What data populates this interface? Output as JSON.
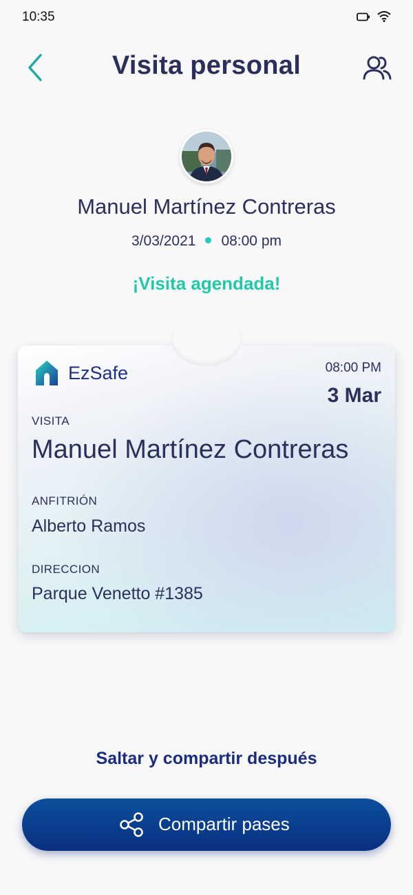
{
  "status_bar": {
    "time": "10:35"
  },
  "header": {
    "title": "Visita personal",
    "back_icon": "chevron-left-icon",
    "people_icon": "users-icon"
  },
  "visitor": {
    "name": "Manuel Martínez Contreras",
    "date": "3/03/2021",
    "time": "08:00 pm",
    "status": "¡Visita agendada!"
  },
  "pass": {
    "brand": "EzSafe",
    "time": "08:00 PM",
    "date": "3 Mar",
    "visit_label": "VISITA",
    "visit_value": "Manuel Martínez Contreras",
    "host_label": "ANFITRIÓN",
    "host_value": "Alberto Ramos",
    "address_label": "DIRECCION",
    "address_value": "Parque Venetto #1385"
  },
  "actions": {
    "skip": "Saltar y compartir después",
    "share": "Compartir pases",
    "share_icon": "share-icon"
  },
  "colors": {
    "primary": "#2b2f5c",
    "accent_teal": "#22c8a8",
    "button": "#0a2f80",
    "brand_blue": "#1e2f86"
  }
}
